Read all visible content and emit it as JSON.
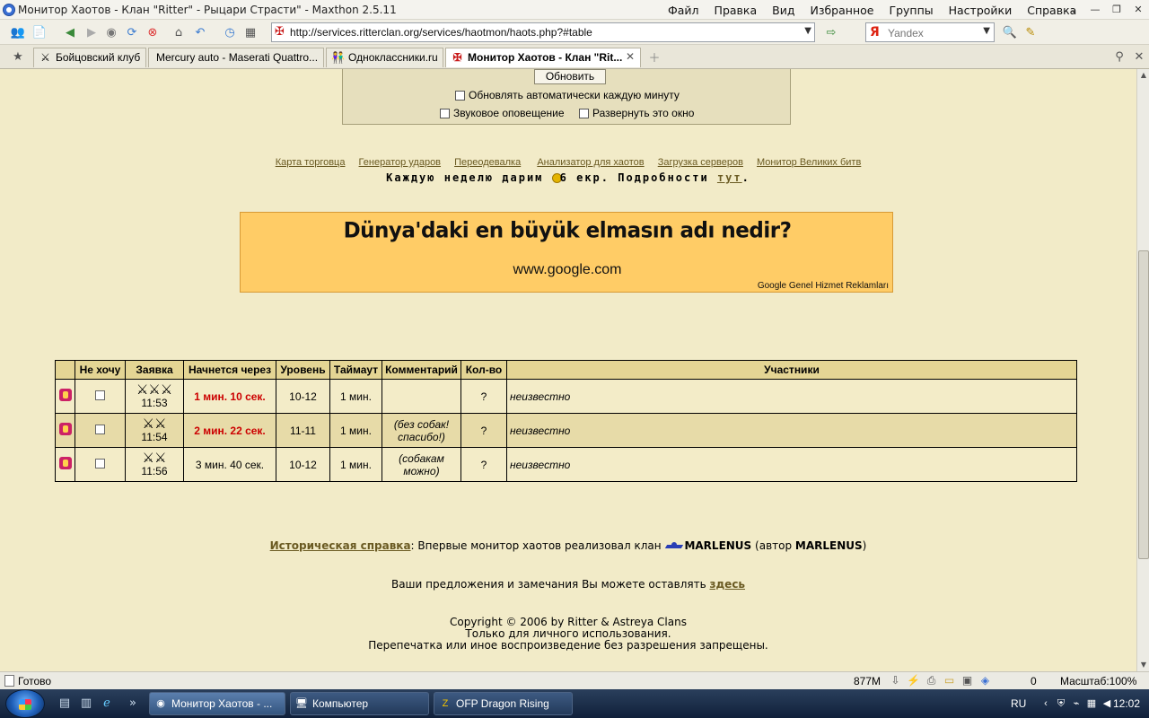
{
  "window": {
    "title": "Монитор Хаотов - Клан \"Ritter\" - Рыцари Страсти\" - Maxthon 2.5.11",
    "menu": [
      "Файл",
      "Правка",
      "Вид",
      "Избранное",
      "Группы",
      "Настройки",
      "Справка"
    ]
  },
  "address": {
    "url": "http://services.ritterclan.org/services/haotmon/haots.php?#table",
    "search_placeholder": "Yandex"
  },
  "tabs": [
    {
      "label": "Бойцовский клуб",
      "icon": "swords-icon"
    },
    {
      "label": "Mercury auto - Maserati Quattro...",
      "icon": ""
    },
    {
      "label": "Одноклассники.ru",
      "icon": "people-icon"
    },
    {
      "label": "Монитор Хаотов - Клан \"Rit...",
      "icon": "ritter-cross-icon",
      "active": true
    }
  ],
  "controls": {
    "refresh_label": "Обновить",
    "auto_refresh_label": "Обновлять автоматически каждую минуту",
    "sound_label": "Звуковое оповещение",
    "expand_label": "Развернуть это окно"
  },
  "links": [
    "Карта торговца",
    "Генератор ударов",
    "Переодевалка",
    "Анализатор для хаотов",
    "Загрузка серверов",
    "Монитор Великих битв"
  ],
  "promo": {
    "before": "Каждую неделю дарим",
    "after": "6 екр. Подробности",
    "link": "тут",
    "end": "."
  },
  "ad": {
    "headline": "Dünya'daki en büyük elmasın adı nedir?",
    "site": "www.google.com",
    "footer": "Google Genel Hizmet Reklamları"
  },
  "table": {
    "headers": [
      "Не хочу",
      "Заявка",
      "Начнется через",
      "Уровень",
      "Таймаут",
      "Комментарий",
      "Кол-во",
      "Участники"
    ],
    "rows": [
      {
        "fighters": "⚔⚔⚔",
        "time": "11:53",
        "starts_in": "1 мин. 10 сек.",
        "starts_red": true,
        "level": "10-12",
        "timeout": "1 мин.",
        "comment": "",
        "count": "?",
        "participants": "неизвестно"
      },
      {
        "fighters": "⚔⚔",
        "time": "11:54",
        "starts_in": "2 мин. 22 сек.",
        "starts_red": true,
        "level": "11-11",
        "timeout": "1 мин.",
        "comment": "(без собак! спасибо!)",
        "count": "?",
        "participants": "неизвестно"
      },
      {
        "fighters": "⚔⚔",
        "time": "11:56",
        "starts_in": "3 мин. 40 сек.",
        "starts_red": false,
        "level": "10-12",
        "timeout": "1 мин.",
        "comment": "(собакам можно)",
        "count": "?",
        "participants": "неизвестно"
      }
    ]
  },
  "history": {
    "link": "Историческая справка",
    "text": ": Впервые монитор хаотов реализовал клан",
    "clan": "MARLENUS",
    "author_prefix": "(автор",
    "author": "MARLENUS",
    "author_suffix": ")"
  },
  "suggest": {
    "text": "Ваши предложения и замечания Вы можете оставлять",
    "link": "здесь"
  },
  "copyright": [
    "Copyright © 2006 by Ritter & Astreya Clans",
    "Только для личного использования.",
    "Перепечатка или иное воспроизведение без разрешения запрещены."
  ],
  "status": {
    "ready": "Готово",
    "memory": "877M",
    "count": "0",
    "zoom": "Масштаб:100%"
  },
  "taskbar": {
    "tasks": [
      "Монитор Хаотов - ...",
      "Компьютер",
      "OFP Dragon Rising"
    ],
    "lang": "RU",
    "clock": "12:02"
  }
}
